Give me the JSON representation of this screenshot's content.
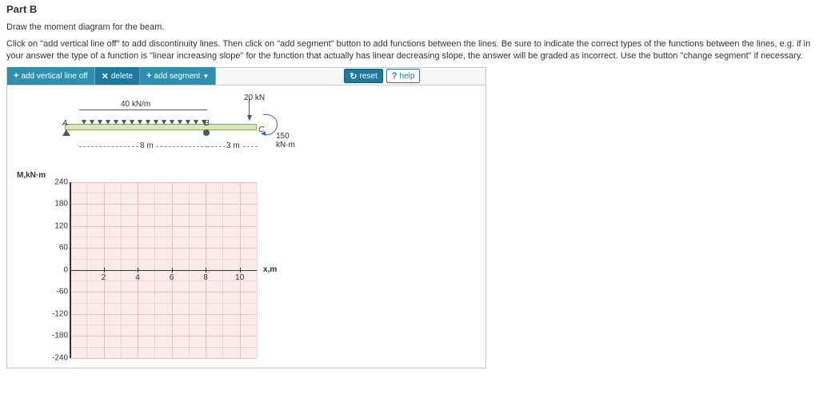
{
  "part_label": "Part B",
  "prompt": "Draw the moment diagram for the beam.",
  "instructions": "Click on \"add vertical line off\" to add discontinuity lines. Then click on \"add segment\" button to add functions between the lines. Be sure to indicate the correct types of the functions between the lines, e.g. if in your answer the type of a function is \"linear increasing slope\" for the function that actually has linear decreasing slope, the answer will be graded as incorrect. Use the button \"change segment\" if necessary.",
  "toolbar": {
    "add_line": "add vertical line off",
    "delete": "delete",
    "add_segment": "add segment",
    "reset": "reset",
    "help": "help"
  },
  "beam": {
    "dist_load_label": "40 kN/m",
    "point_load_label": "20 kN",
    "moment_label": "150 kN·m",
    "point_A": "A",
    "point_B": "B",
    "point_C": "C",
    "span_AB": "8 m",
    "span_BC": "3 m"
  },
  "chart_data": {
    "type": "line",
    "title": "",
    "ylabel": "M,kN·m",
    "xlabel": "x,m",
    "xlim": [
      0,
      11
    ],
    "ylim": [
      -240,
      240
    ],
    "x_ticks": [
      2,
      4,
      6,
      8,
      10
    ],
    "y_ticks": [
      240,
      180,
      120,
      60,
      0,
      -60,
      -120,
      -180,
      -240
    ],
    "series": []
  }
}
